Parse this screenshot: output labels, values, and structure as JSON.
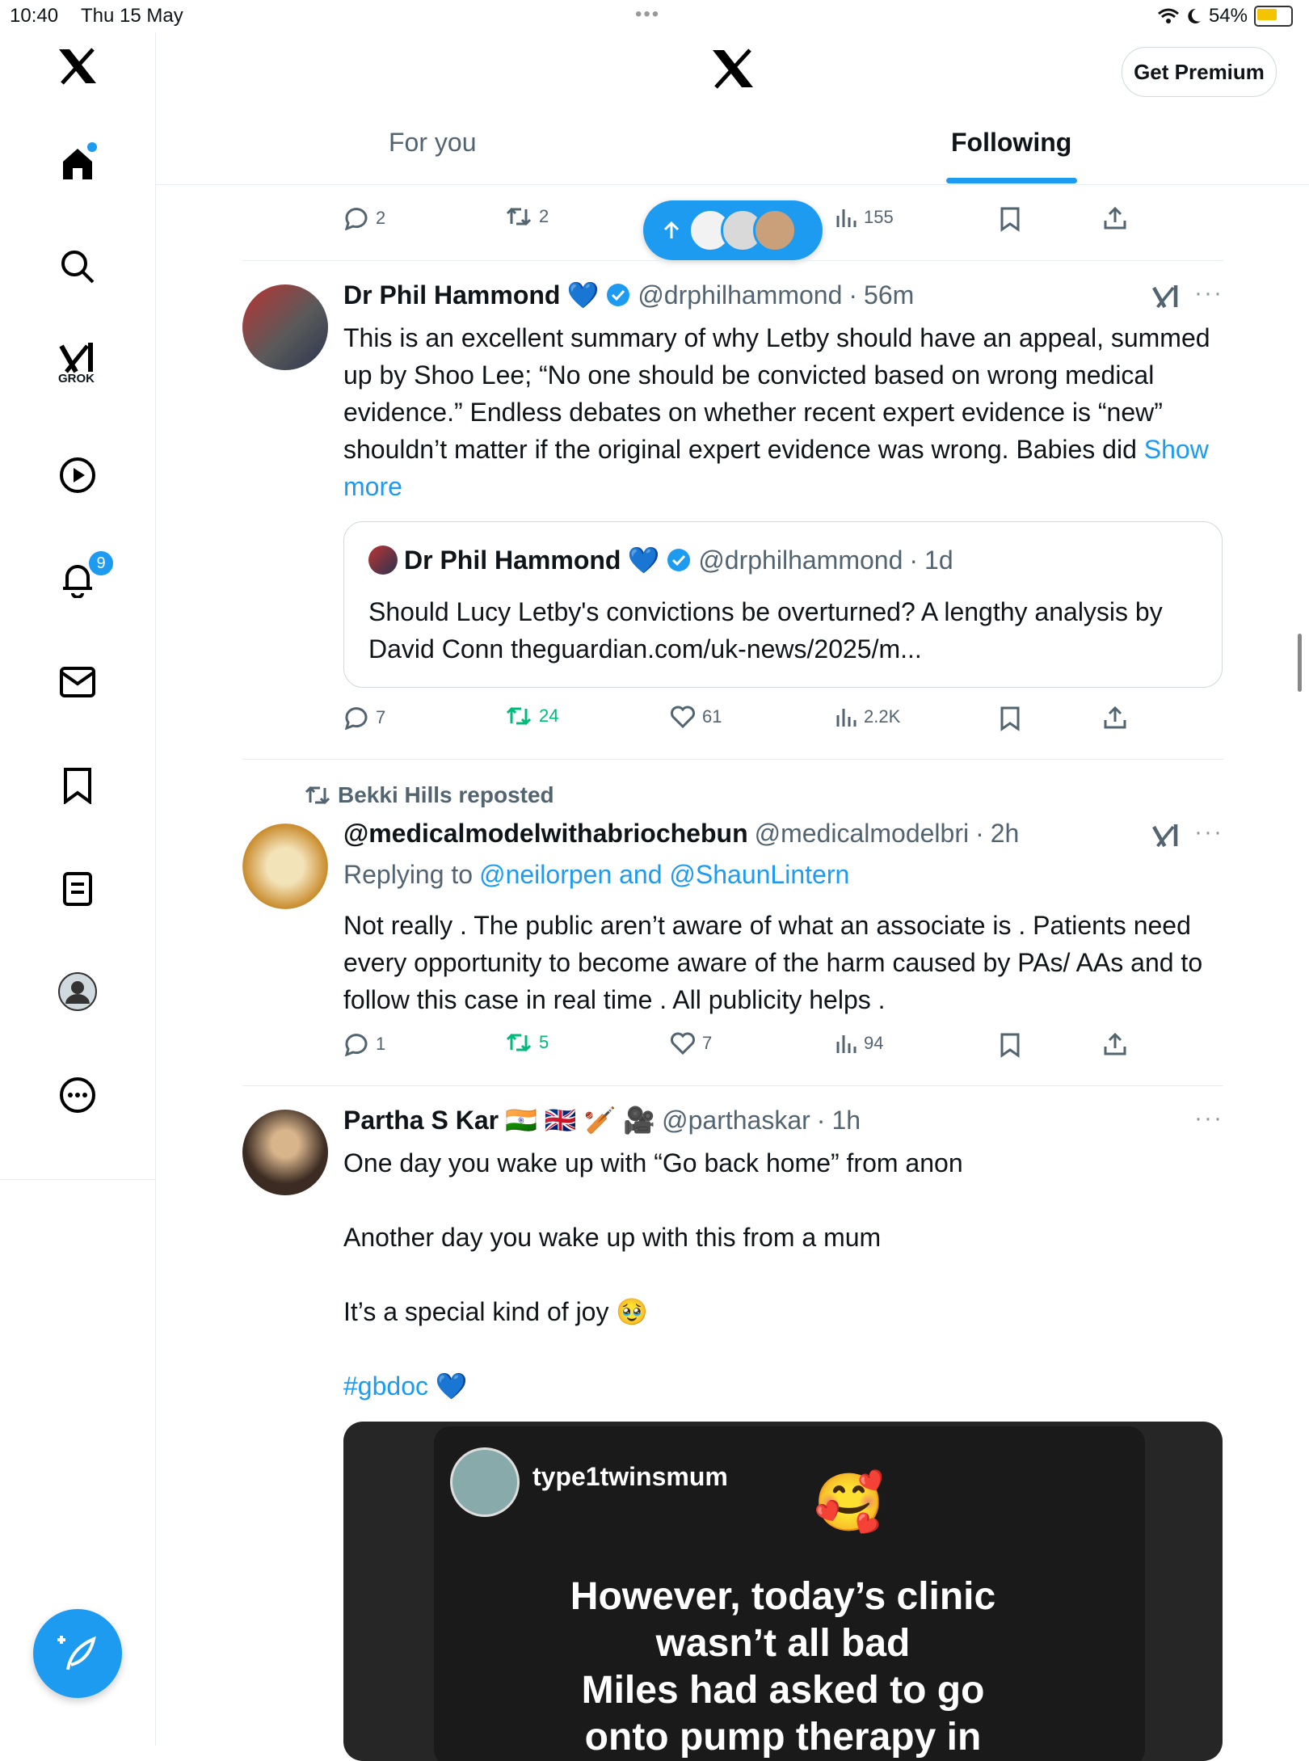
{
  "status_bar": {
    "time": "10:40",
    "date": "Thu 15 May",
    "battery": "54%",
    "battery_level": 0.54
  },
  "header": {
    "get_premium": "Get Premium",
    "tabs": [
      "For you",
      "Following"
    ]
  },
  "sidebar": {
    "grok_label": "GROK",
    "notifications_badge": "9"
  },
  "top_actions": {
    "replies": "2",
    "reposts": "2",
    "views": "155"
  },
  "tweets": [
    {
      "name": "Dr Phil Hammond",
      "handle": "@drphilhammond",
      "time": "56m",
      "text": "This is an excellent summary of why Letby should have an appeal, summed up by Shoo Lee; “No one should be convicted based on wrong medical evidence.” Endless debates on whether recent expert evidence is “new” shouldn’t matter if the original expert evidence was wrong. Babies did",
      "show_more": "Show more",
      "quote": {
        "name": "Dr Phil Hammond",
        "handle": "@drphilhammond",
        "time": "1d",
        "text": "Should Lucy Letby's convictions be overturned? A lengthy analysis by David Conn  theguardian.com/uk-news/2025/m..."
      },
      "replies": "7",
      "reposts": "24",
      "likes": "61",
      "views": "2.2K"
    },
    {
      "repost_label": "Bekki Hills reposted",
      "name": "@medicalmodelwithabriochebun",
      "handle": "@medicalmodelbri",
      "time": "2h",
      "replying_prefix": "Replying to",
      "replying_to": "@neilorpen and @ShaunLintern",
      "text": "Not really . The public aren’t aware of what an associate is . Patients need every opportunity to become aware of the harm caused by PAs/ AAs and to follow this case in real time . All publicity helps .",
      "replies": "1",
      "reposts": "5",
      "likes": "7",
      "views": "94"
    },
    {
      "name": "Partha S Kar",
      "name_emoji": "🇮🇳 🇬🇧 🏏 🎥",
      "handle": "@parthaskar",
      "time": "1h",
      "line1": "One day you wake up with “Go back home” from anon",
      "line2": "Another day you wake up with this from a mum",
      "line3": "It’s a special kind of joy 🥹",
      "hashtag": "#gbdoc",
      "heart": "💙",
      "media": {
        "username": "type1twinsmum",
        "emoji": "🥰",
        "text_lines": [
          "However, today’s clinic",
          "wasn’t all bad",
          "Miles had asked to go",
          "onto pump therapy in"
        ]
      }
    }
  ],
  "sep_dot": "·",
  "heart_emoji": "💙"
}
